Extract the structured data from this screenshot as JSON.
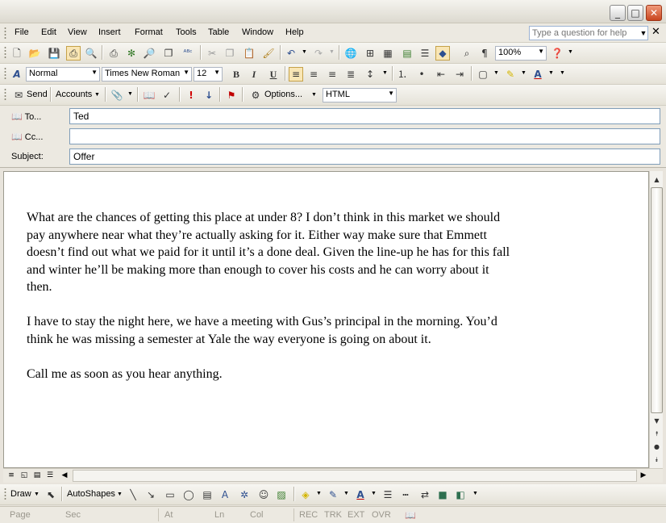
{
  "titlebar": {
    "min_glyph": "_",
    "max_glyph": "□",
    "close_glyph": "✕"
  },
  "menu": {
    "items": [
      "File",
      "Edit",
      "View",
      "Insert",
      "Format",
      "Tools",
      "Table",
      "Window",
      "Help"
    ],
    "help_placeholder": "Type a question for help"
  },
  "standard_toolbar": {
    "zoom": "100%"
  },
  "formatting_toolbar": {
    "style": "Normal",
    "font": "Times New Roman",
    "size": "12"
  },
  "mail_toolbar": {
    "send": "Send",
    "accounts": "Accounts",
    "options": "Options...",
    "format": "HTML"
  },
  "header": {
    "to_label": "To...",
    "to_value": "Ted",
    "cc_label": "Cc...",
    "cc_value": "",
    "subject_label": "Subject:",
    "subject_value": "Offer"
  },
  "body": {
    "paragraphs": [
      "What are the chances of getting this place at under 8? I don’t think in this market we should pay anywhere near what they’re actually asking for it. Either way make sure that Emmett doesn’t find out what we paid for it until it’s a done deal. Given the line-up he has for this fall and winter he’ll be making more than enough to cover his costs and he can worry about it then.",
      "I have to stay the night here, we have a meeting with Gus’s principal in the morning. You’d think he was missing a semester at Yale the way everyone is going on about it.",
      "Call me as soon as you hear anything."
    ]
  },
  "drawing_toolbar": {
    "draw": "Draw",
    "autoshapes": "AutoShapes"
  },
  "status": {
    "page": "Page",
    "sec": "Sec",
    "at": "At",
    "ln": "Ln",
    "col": "Col",
    "rec": "REC",
    "trk": "TRK",
    "ext": "EXT",
    "ovr": "OVR"
  },
  "colors": {
    "accent": "#316ac5",
    "close": "#c8451f",
    "highlight": "#f9e6b5"
  }
}
